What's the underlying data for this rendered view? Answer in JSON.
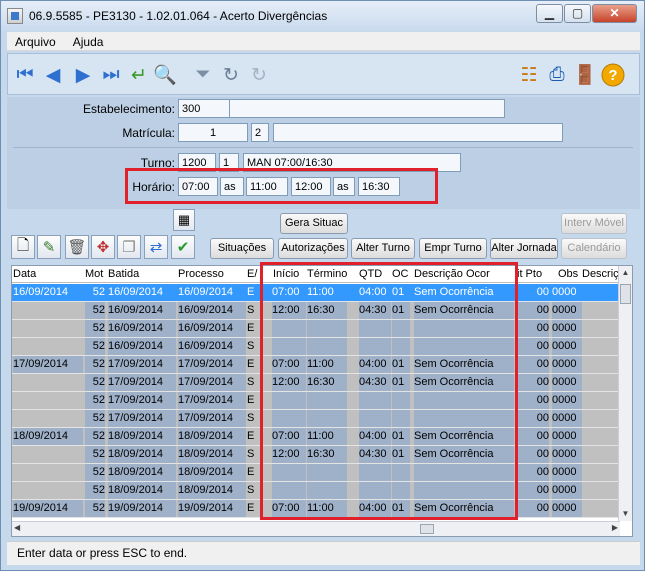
{
  "window": {
    "title": "06.9.5585 - PE3130 - 1.02.01.064 - Acerto Divergências",
    "minimize": "▁",
    "maximize": "▢",
    "close": "✕"
  },
  "menu": [
    "Arquivo",
    "Ajuda"
  ],
  "form": {
    "estabelecimento_label": "Estabelecimento:",
    "estabelecimento_value": "300",
    "estabelecimento_desc": "",
    "matricula_label": "Matrícula:",
    "matricula_value": "1",
    "matricula_digit": "2",
    "matricula_name": "",
    "turno_label": "Turno:",
    "turno_value": "1200",
    "turno_seq": "1",
    "turno_desc": "MAN 07:00/16:30",
    "horario_label": "Horário:",
    "horario": [
      "07:00",
      "as",
      "11:00",
      "12:00",
      "as",
      "16:30"
    ]
  },
  "buttons": {
    "gera_situac": "Gera Situac",
    "interv_movel": "Interv Móvel",
    "situacoes": "Situações",
    "autorizacoes": "Autorizações",
    "alter_turno": "Alter Turno",
    "empr_turno": "Empr Turno",
    "alter_jornada": "Alter Jornada",
    "calendario": "Calendário"
  },
  "grid": {
    "headers": [
      "Data",
      "Mot",
      "Batida",
      "Processo",
      "E/",
      "Início",
      "Término",
      "QTD",
      "OC",
      "Descrição Ocor",
      "it Pto",
      "Obs",
      "Descriçã"
    ],
    "rows": [
      {
        "data": "16/09/2014",
        "mot": "52",
        "batida": "16/09/2014",
        "processo": "16/09/2014",
        "es": "E",
        "inicio": "07:00",
        "termino": "11:00",
        "qtd": "04:00",
        "oc": "01",
        "desc": "Sem Ocorrência",
        "pto": "00",
        "obs": "0000"
      },
      {
        "data": "",
        "mot": "52",
        "batida": "16/09/2014",
        "processo": "16/09/2014",
        "es": "S",
        "inicio": "12:00",
        "termino": "16:30",
        "qtd": "04:30",
        "oc": "01",
        "desc": "Sem Ocorrência",
        "pto": "00",
        "obs": "0000"
      },
      {
        "data": "",
        "mot": "52",
        "batida": "16/09/2014",
        "processo": "16/09/2014",
        "es": "E",
        "inicio": "",
        "termino": "",
        "qtd": "",
        "oc": "",
        "desc": "",
        "pto": "00",
        "obs": "0000"
      },
      {
        "data": "",
        "mot": "52",
        "batida": "16/09/2014",
        "processo": "16/09/2014",
        "es": "S",
        "inicio": "",
        "termino": "",
        "qtd": "",
        "oc": "",
        "desc": "",
        "pto": "00",
        "obs": "0000"
      },
      {
        "data": "17/09/2014",
        "mot": "52",
        "batida": "17/09/2014",
        "processo": "17/09/2014",
        "es": "E",
        "inicio": "07:00",
        "termino": "11:00",
        "qtd": "04:00",
        "oc": "01",
        "desc": "Sem Ocorrência",
        "pto": "00",
        "obs": "0000"
      },
      {
        "data": "",
        "mot": "52",
        "batida": "17/09/2014",
        "processo": "17/09/2014",
        "es": "S",
        "inicio": "12:00",
        "termino": "16:30",
        "qtd": "04:30",
        "oc": "01",
        "desc": "Sem Ocorrência",
        "pto": "00",
        "obs": "0000"
      },
      {
        "data": "",
        "mot": "52",
        "batida": "17/09/2014",
        "processo": "17/09/2014",
        "es": "E",
        "inicio": "",
        "termino": "",
        "qtd": "",
        "oc": "",
        "desc": "",
        "pto": "00",
        "obs": "0000"
      },
      {
        "data": "",
        "mot": "52",
        "batida": "17/09/2014",
        "processo": "17/09/2014",
        "es": "S",
        "inicio": "",
        "termino": "",
        "qtd": "",
        "oc": "",
        "desc": "",
        "pto": "00",
        "obs": "0000"
      },
      {
        "data": "18/09/2014",
        "mot": "52",
        "batida": "18/09/2014",
        "processo": "18/09/2014",
        "es": "E",
        "inicio": "07:00",
        "termino": "11:00",
        "qtd": "04:00",
        "oc": "01",
        "desc": "Sem Ocorrência",
        "pto": "00",
        "obs": "0000"
      },
      {
        "data": "",
        "mot": "52",
        "batida": "18/09/2014",
        "processo": "18/09/2014",
        "es": "S",
        "inicio": "12:00",
        "termino": "16:30",
        "qtd": "04:30",
        "oc": "01",
        "desc": "Sem Ocorrência",
        "pto": "00",
        "obs": "0000"
      },
      {
        "data": "",
        "mot": "52",
        "batida": "18/09/2014",
        "processo": "18/09/2014",
        "es": "E",
        "inicio": "",
        "termino": "",
        "qtd": "",
        "oc": "",
        "desc": "",
        "pto": "00",
        "obs": "0000"
      },
      {
        "data": "",
        "mot": "52",
        "batida": "18/09/2014",
        "processo": "18/09/2014",
        "es": "S",
        "inicio": "",
        "termino": "",
        "qtd": "",
        "oc": "",
        "desc": "",
        "pto": "00",
        "obs": "0000"
      },
      {
        "data": "19/09/2014",
        "mot": "52",
        "batida": "19/09/2014",
        "processo": "19/09/2014",
        "es": "E",
        "inicio": "07:00",
        "termino": "11:00",
        "qtd": "04:00",
        "oc": "01",
        "desc": "Sem Ocorrência",
        "pto": "00",
        "obs": "0000"
      }
    ]
  },
  "status": "Enter data or press ESC to end.",
  "colors": {
    "highlight": "#e0202a",
    "selection": "#3399ff"
  }
}
